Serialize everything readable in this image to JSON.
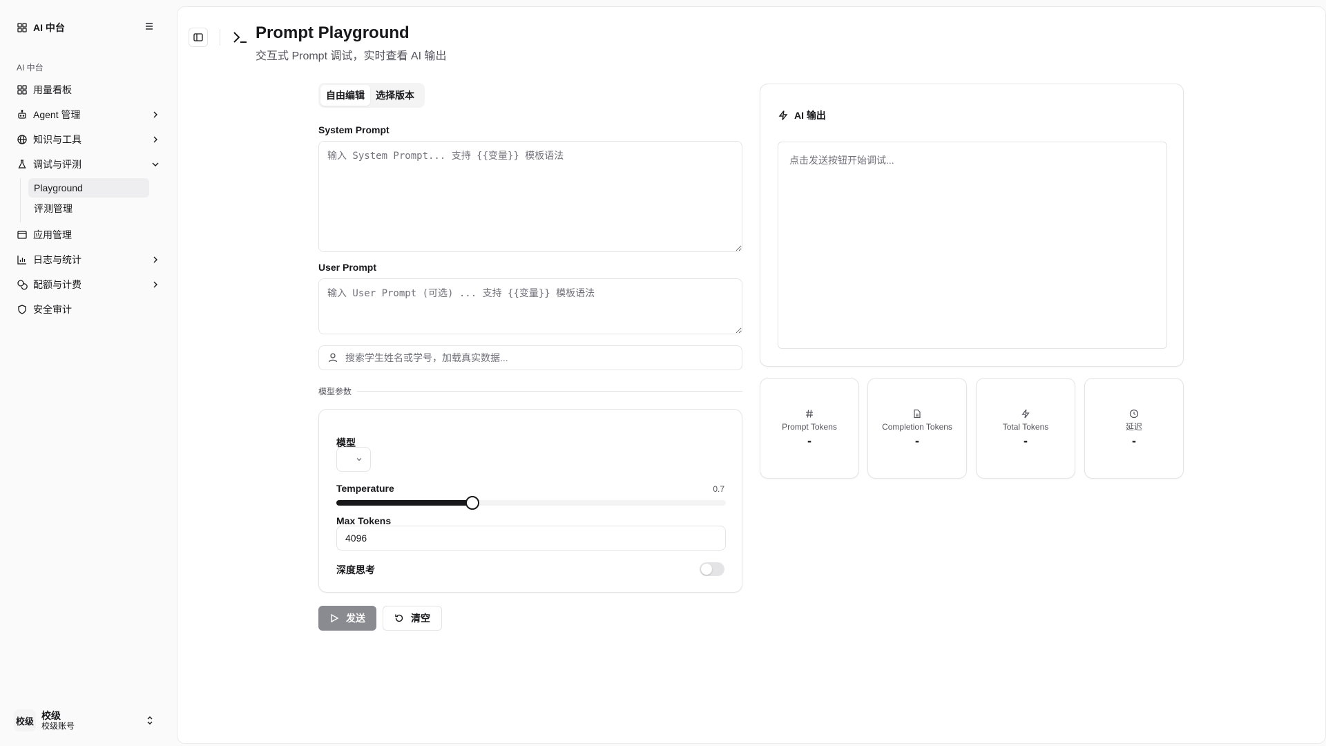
{
  "sidebar": {
    "brand": "AI 中台",
    "group_label": "AI 中台",
    "items": [
      {
        "label": "用量看板"
      },
      {
        "label": "Agent 管理"
      },
      {
        "label": "知识与工具"
      },
      {
        "label": "调试与评测"
      },
      {
        "label": "应用管理"
      },
      {
        "label": "日志与统计"
      },
      {
        "label": "配额与计费"
      },
      {
        "label": "安全审计"
      }
    ],
    "sub_items": [
      {
        "label": "Playground",
        "active": true
      },
      {
        "label": "评测管理"
      }
    ],
    "user": {
      "avatar": "校级",
      "name": "校级",
      "account": "校级账号"
    }
  },
  "header": {
    "title": "Prompt Playground",
    "subtitle": "交互式 Prompt 调试，实时查看 AI 输出"
  },
  "editor": {
    "tabs": [
      "自由编辑",
      "选择版本"
    ],
    "system_label": "System Prompt",
    "system_placeholder": "输入 System Prompt... 支持 {{变量}} 模板语法",
    "user_label": "User Prompt",
    "user_placeholder": "输入 User Prompt (可选) ... 支持 {{变量}} 模板语法",
    "search_placeholder": "搜索学生姓名或学号，加载真实数据..."
  },
  "params": {
    "section_label": "模型参数",
    "model_label": "模型",
    "temperature_label": "Temperature",
    "temperature": 0.7,
    "temperature_display": "0.7",
    "max_tokens_label": "Max Tokens",
    "max_tokens": "4096",
    "deep_think_label": "深度思考",
    "deep_think_on": false
  },
  "actions": {
    "send": "发送",
    "clear": "清空"
  },
  "output": {
    "title": "AI 输出",
    "placeholder": "点击发送按钮开始调试..."
  },
  "stats": [
    {
      "label": "Prompt Tokens",
      "value": "-",
      "icon": "hash-icon"
    },
    {
      "label": "Completion Tokens",
      "value": "-",
      "icon": "file-icon"
    },
    {
      "label": "Total Tokens",
      "value": "-",
      "icon": "zap-icon"
    },
    {
      "label": "延迟",
      "value": "-",
      "icon": "clock-icon"
    }
  ],
  "colors": {
    "accent": "#18181b",
    "send_button": "#8a8a91",
    "border": "#e4e4e7"
  }
}
